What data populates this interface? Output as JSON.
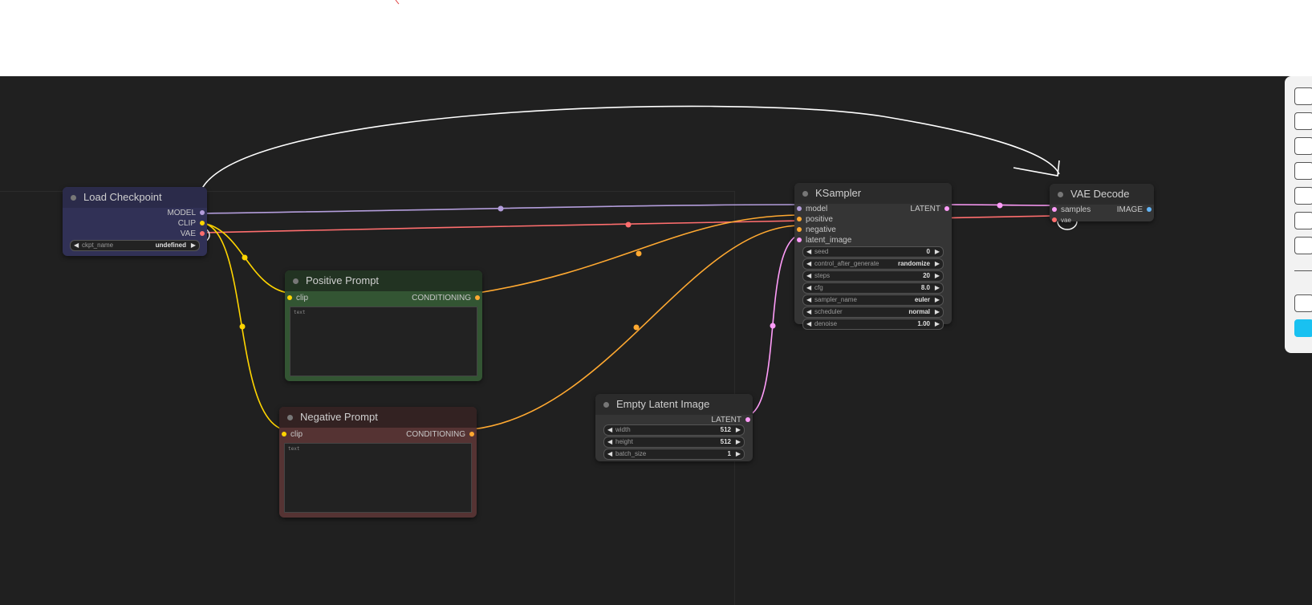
{
  "colors": {
    "canvas_bg": "#202020",
    "model": "#b39ddb",
    "clip": "#ffd500",
    "vae": "#ff6e6e",
    "conditioning": "#ffa931",
    "latent": "#ff9cf9",
    "image": "#64b5f6",
    "toolbar_accent": "#19c1f1"
  },
  "nodes": {
    "load_checkpoint": {
      "title": "Load Checkpoint",
      "outputs": [
        "MODEL",
        "CLIP",
        "VAE"
      ],
      "widgets": [
        {
          "name": "ckpt_name",
          "value": "undefined"
        }
      ]
    },
    "positive_prompt": {
      "title": "Positive Prompt",
      "input": "clip",
      "output": "CONDITIONING",
      "text": "text"
    },
    "negative_prompt": {
      "title": "Negative Prompt",
      "input": "clip",
      "output": "CONDITIONING",
      "text": "text"
    },
    "ksampler": {
      "title": "KSampler",
      "inputs": [
        "model",
        "positive",
        "negative",
        "latent_image"
      ],
      "output": "LATENT",
      "widgets": [
        {
          "name": "seed",
          "value": "0"
        },
        {
          "name": "control_after_generate",
          "value": "randomize"
        },
        {
          "name": "steps",
          "value": "20"
        },
        {
          "name": "cfg",
          "value": "8.0"
        },
        {
          "name": "sampler_name",
          "value": "euler"
        },
        {
          "name": "scheduler",
          "value": "normal"
        },
        {
          "name": "denoise",
          "value": "1.00"
        }
      ]
    },
    "empty_latent": {
      "title": "Empty Latent Image",
      "output": "LATENT",
      "widgets": [
        {
          "name": "width",
          "value": "512"
        },
        {
          "name": "height",
          "value": "512"
        },
        {
          "name": "batch_size",
          "value": "1"
        }
      ]
    },
    "vae_decode": {
      "title": "VAE Decode",
      "inputs": [
        "samples",
        "vae"
      ],
      "output": "IMAGE"
    }
  },
  "toolbar": {
    "icons": [
      "toolbar-button-1-icon",
      "toolbar-button-2-icon",
      "toolbar-button-3-icon",
      "toolbar-button-4-icon",
      "toolbar-button-5-icon",
      "toolbar-button-6-icon",
      "toolbar-button-7-icon",
      "toolbar-button-8-icon",
      "toolbar-button-9-icon"
    ]
  }
}
